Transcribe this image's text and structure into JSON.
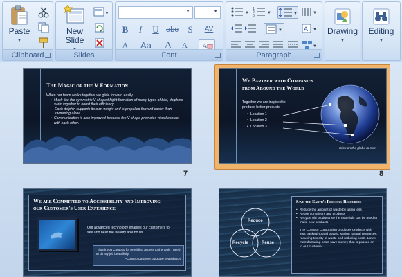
{
  "ribbon": {
    "clipboard": {
      "label": "Clipboard",
      "paste": "Paste"
    },
    "slides": {
      "label": "Slides",
      "new_slide": "New Slide"
    },
    "font": {
      "label": "Font",
      "bold": "B",
      "italic": "I",
      "underline": "U",
      "strike": "abc",
      "shadow": "S",
      "spacing": "AV",
      "color": "A",
      "case": "Aa",
      "grow": "A",
      "shrink": "A"
    },
    "paragraph": {
      "label": "Paragraph"
    },
    "drawing": {
      "label": "Drawing"
    },
    "editing": {
      "label": "Editing"
    }
  },
  "slides": [
    {
      "number": "7",
      "title": "The Magic of the V Formation",
      "intro": "When our team works together we glide forward easily",
      "bullets": [
        "Much like the symmetric V-shaped flight formation of many types of bird, dolphins swim together to boost their efficiency.",
        "Each dolphin supports its own weight and is propelled forward easier than swimming alone.",
        "Communication is also improved because the V shape promotes visual contact with each other."
      ]
    },
    {
      "number": "8",
      "title_line1": "We Partner with Companies",
      "title_line2": "from Around the World",
      "intro_line1": "Together we are inspired to",
      "intro_line2": "produce better products",
      "locations": [
        "Location 1",
        "Location 2",
        "Location 3"
      ],
      "caption": "Click on the globe to start"
    },
    {
      "title_line1": "We are Committed to Accessibility and Improving",
      "title_line2": "our Customer's User Experience",
      "body": "Our advanced technology enables our customers to see and hear the beauty around us.",
      "quote": "\"Thank you Contoso for providing access to the tools I need to do my job beautifully!\"",
      "quote_author": "~Contoso Customer, Spokane, Washington"
    },
    {
      "title": "Save the Earth's Precious Resources",
      "circles": [
        "Reduce",
        "Recycle",
        "Reuse"
      ],
      "bullets": [
        "Reduce the amount of waste by using less",
        "Reuse containers and products",
        "Recycle old products so the materials can be used to make new products"
      ],
      "body": "The Contoso Corporation produces products with less packaging and plastic, saving natural resources, reducing toxicity of waste and reducing costs. Lower manufacturing costs save money that is passed on to our customer"
    }
  ],
  "colors": {
    "selection": "#f0b46a",
    "ribbon_text": "#3e5f8c",
    "slide_bg": "#0d1626"
  }
}
